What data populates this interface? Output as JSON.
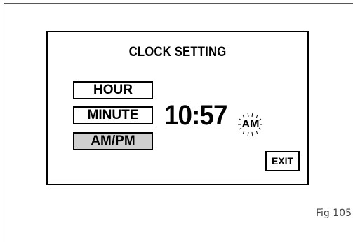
{
  "screen": {
    "title": "CLOCK SETTING",
    "buttons": {
      "hour": "HOUR",
      "minute": "MINUTE",
      "ampm": "AM/PM",
      "exit": "EXIT"
    },
    "time": "10:57",
    "period": "AM",
    "selected_button": "AM/PM",
    "period_blinking": true
  },
  "caption": "Fig 105",
  "colors": {
    "selected_button_bg": "#cfcfcf",
    "text": "#000000"
  }
}
